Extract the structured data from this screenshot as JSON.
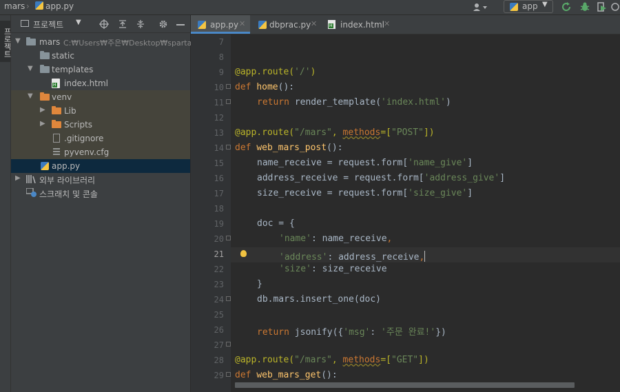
{
  "breadcrumb": {
    "project": "mars",
    "file": "app.py"
  },
  "toolbar": {
    "run_config": "app"
  },
  "left_strip": {
    "label": "프로젝트"
  },
  "project_panel": {
    "title": "프로젝트",
    "root": {
      "name": "mars",
      "path": "C:₩Users₩주은₩Desktop₩sparta₩"
    },
    "items": [
      {
        "label": "static"
      },
      {
        "label": "templates"
      },
      {
        "label": "index.html"
      },
      {
        "label": "venv"
      },
      {
        "label": "Lib"
      },
      {
        "label": "Scripts"
      },
      {
        "label": ".gitignore"
      },
      {
        "label": "pyvenv.cfg"
      },
      {
        "label": "app.py"
      },
      {
        "label": "외부 라이브러리"
      },
      {
        "label": "스크래치 및 콘솔"
      }
    ]
  },
  "tabs": [
    {
      "label": "app.py"
    },
    {
      "label": "dbprac.py"
    },
    {
      "label": "index.html"
    }
  ],
  "code_lines": [
    {
      "n": "7"
    },
    {
      "n": "8"
    },
    {
      "n": "9"
    },
    {
      "n": "10"
    },
    {
      "n": "11"
    },
    {
      "n": "12"
    },
    {
      "n": "13"
    },
    {
      "n": "14"
    },
    {
      "n": "15"
    },
    {
      "n": "16"
    },
    {
      "n": "17"
    },
    {
      "n": "18"
    },
    {
      "n": "19"
    },
    {
      "n": "20"
    },
    {
      "n": "21"
    },
    {
      "n": "22"
    },
    {
      "n": "23"
    },
    {
      "n": "24"
    },
    {
      "n": "25"
    },
    {
      "n": "26"
    },
    {
      "n": "27"
    },
    {
      "n": "28"
    },
    {
      "n": "29"
    }
  ],
  "code": {
    "l9_dec": "@app.route(",
    "l9_str": "'/'",
    "l9_end": ")",
    "l10_kw": "def ",
    "l10_fn": "home",
    "l10_end": "():",
    "l11_kw": "return ",
    "l11_a": "render_template(",
    "l11_str": "'index.html'",
    "l11_end": ")",
    "l13_dec": "@app.route(",
    "l13_str": "\"/mars\"",
    "l13_b": ", ",
    "l13_m": "methods",
    "l13_c": "=[",
    "l13_str2": "\"POST\"",
    "l13_end": "])",
    "l14_kw": "def ",
    "l14_fn": "web_mars_post",
    "l14_end": "():",
    "l15_a": "name_receive = request.form[",
    "l15_str": "'name_give'",
    "l15_end": "]",
    "l16_a": "address_receive = request.form[",
    "l16_str": "'address_give'",
    "l16_end": "]",
    "l17_a": "size_receive = request.form[",
    "l17_str": "'size_give'",
    "l17_end": "]",
    "l19_a": "doc = {",
    "l20_str": "'name'",
    "l20_a": ": name_receive",
    "l20_c": ",",
    "l21_str": "'address'",
    "l21_a": ": address_receive",
    "l21_c": ",",
    "l22_str": "'size'",
    "l22_a": ": size_receive",
    "l23_a": "}",
    "l24_a": "db.mars.insert_one(doc)",
    "l26_kw": "return ",
    "l26_a": "jsonify({",
    "l26_str": "'msg'",
    "l26_b": ": ",
    "l26_str2": "'주문 완료!'",
    "l26_end": "})",
    "l28_dec": "@app.route(",
    "l28_str": "\"/mars\"",
    "l28_b": ", ",
    "l28_m": "methods",
    "l28_c": "=[",
    "l28_str2": "\"GET\"",
    "l28_end": "])",
    "l29_kw": "def ",
    "l29_fn": "web_mars_get",
    "l29_end": "():"
  }
}
